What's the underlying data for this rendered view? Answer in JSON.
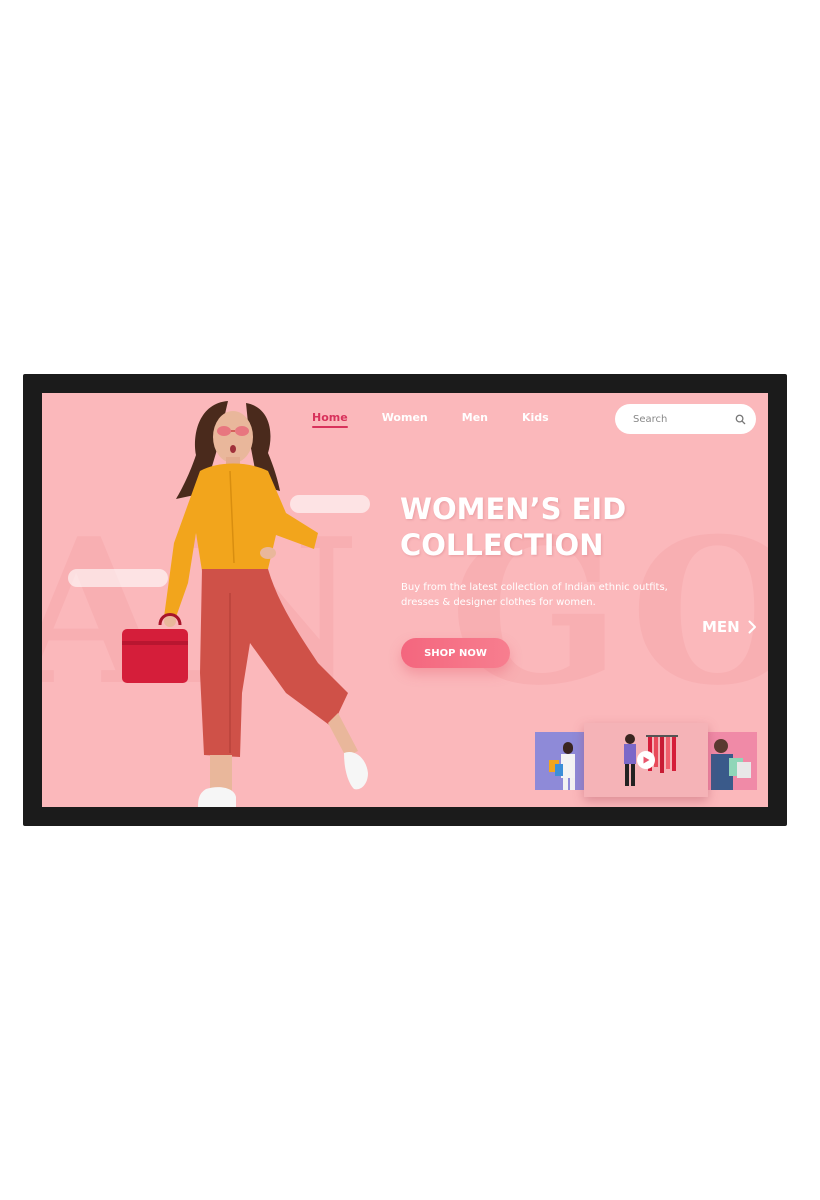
{
  "nav": {
    "items": [
      {
        "label": "Home",
        "active": true
      },
      {
        "label": "Women",
        "active": false
      },
      {
        "label": "Men",
        "active": false
      },
      {
        "label": "Kids",
        "active": false
      }
    ]
  },
  "search": {
    "placeholder": "Search",
    "icon": "search-icon"
  },
  "hero": {
    "title_line1": "WOMEN’S EID",
    "title_line2": "COLLECTION",
    "desc_line1": "Buy from the latest collection of Indian ethnic outfits,",
    "desc_line2": "dresses & designer clothes for women.",
    "cta_label": "SHOP NOW"
  },
  "next_category": {
    "label": "MEN",
    "icon": "chevron-right-icon"
  },
  "thumbnails": [
    {
      "name": "shopping-bags-thumbnail"
    },
    {
      "name": "video-thumbnail",
      "icon": "play-icon"
    },
    {
      "name": "bags-thumbnail"
    }
  ],
  "colors": {
    "background": "#fbb8bb",
    "accent": "#d8325b",
    "button": "#f4667e",
    "frame": "#1b1b1b"
  }
}
